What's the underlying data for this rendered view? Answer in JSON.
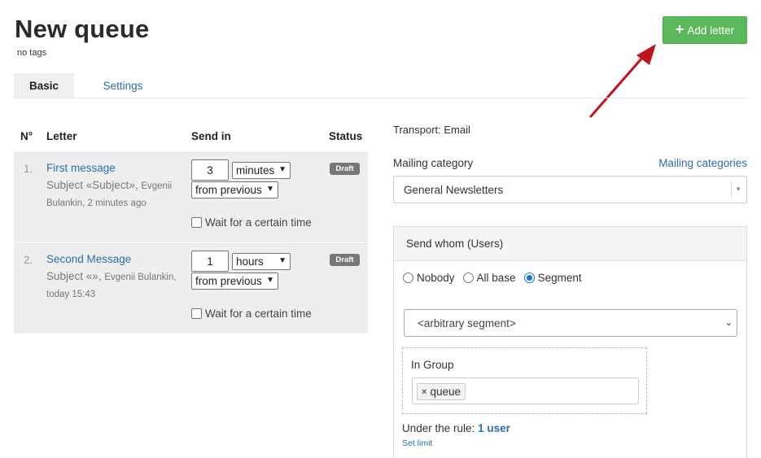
{
  "header": {
    "title": "New queue",
    "tags": "no tags",
    "add_letter_label": "Add letter"
  },
  "tabs": [
    {
      "label": "Basic"
    },
    {
      "label": "Settings"
    }
  ],
  "table": {
    "headers": {
      "num": "N°",
      "letter": "Letter",
      "send_in": "Send in",
      "status": "Status"
    },
    "rows": [
      {
        "num": "1.",
        "name": "First message",
        "subject": "Subject «Subject»,",
        "author": "Evgenii",
        "meta": "Bulankin, 2 minutes ago",
        "amount": "3",
        "unit": "minutes",
        "from": "from previous",
        "wait_label": "Wait for a certain time",
        "status": "Draft"
      },
      {
        "num": "2.",
        "name": "Second Message",
        "subject": "Subject «»,",
        "author": "Evgenii Bulankin,",
        "meta": "today 15:43",
        "amount": "1",
        "unit": "hours",
        "from": "from previous",
        "wait_label": "Wait for a certain time",
        "status": "Draft"
      }
    ]
  },
  "settings": {
    "transport": "Transport: Email",
    "mailing_category_label": "Mailing category",
    "mailing_categories_link": "Mailing categories",
    "mailing_category_value": "General Newsletters",
    "send_whom": {
      "title": "Send whom (Users)",
      "options": [
        "Nobody",
        "All base",
        "Segment"
      ],
      "selected": "Segment",
      "segment_value": "<arbitrary segment>",
      "group_label": "In Group",
      "group_tag": "queue",
      "rule_label": "Under the rule:",
      "rule_count": "1 user",
      "set_limit": "Set limit"
    }
  },
  "colors": {
    "accent": "#2a6eab",
    "button": "#5cb85c",
    "arrow": "#c0141c",
    "badge": "#777777"
  }
}
